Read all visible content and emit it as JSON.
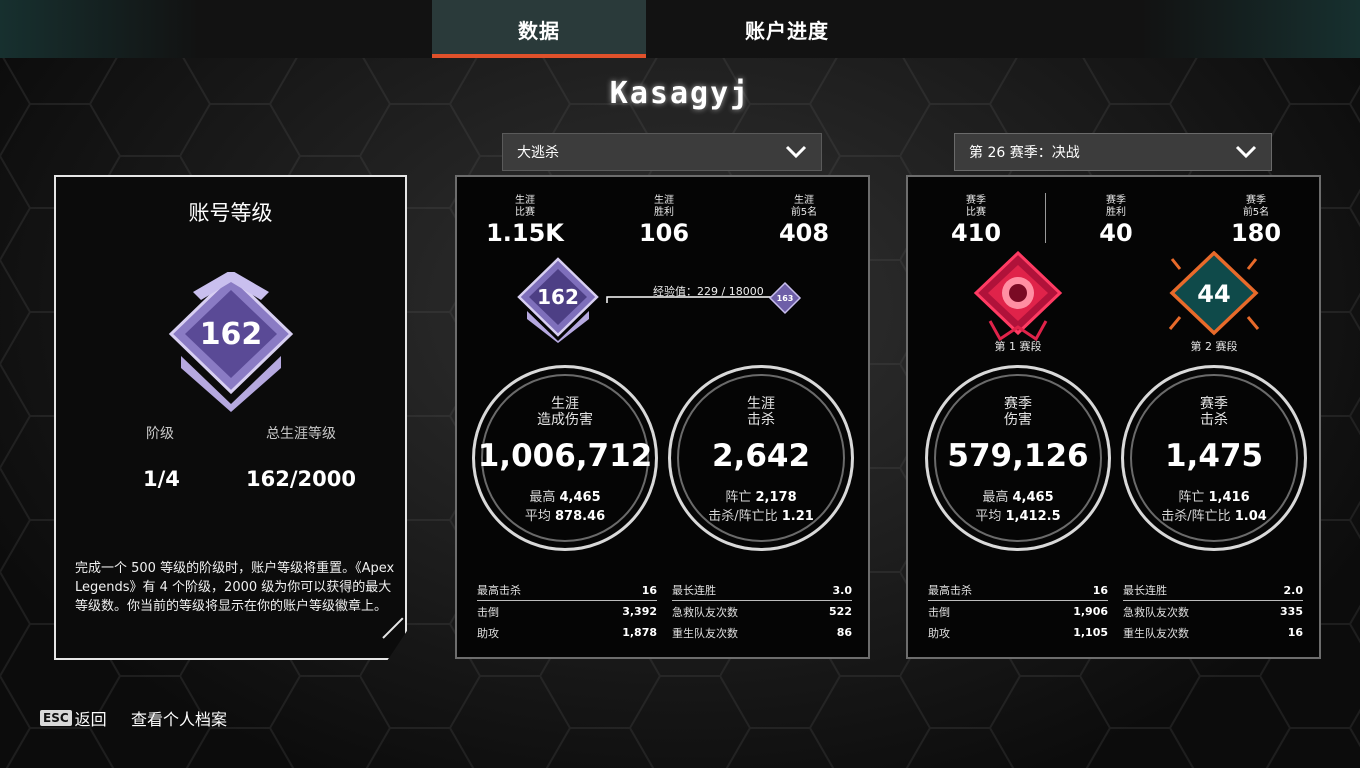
{
  "tabs": [
    {
      "label": "数据",
      "active": true
    },
    {
      "label": "账户进度",
      "active": false
    }
  ],
  "player_name": "Kasagyj",
  "mode_select": {
    "value": "大逃杀"
  },
  "season_select": {
    "value": "第 26 赛季：决战"
  },
  "account": {
    "title": "账号等级",
    "badge_level": "162",
    "tier_label": "阶级",
    "tier_value": "1/4",
    "total_label": "总生涯等级",
    "total_value": "162/2000",
    "description": "完成一个 500 等级的阶级时，账户等级将重置。《Apex Legends》有 4 个阶级，2000 级为你可以获得的最大等级数。你当前的等级将显示在你的账户等级徽章上。"
  },
  "career": {
    "top": [
      {
        "label": "生涯\n比赛",
        "value": "1.15K"
      },
      {
        "label": "生涯\n胜利",
        "value": "106"
      },
      {
        "label": "生涯\n前5名",
        "value": "408"
      }
    ],
    "level_badge": "162",
    "next_level_badge": "163",
    "exp_text": "经验值：229 / 18000",
    "damage": {
      "title": "生涯\n造成伤害",
      "value": "1,006,712",
      "sub1_label": "最高",
      "sub1_value": "4,465",
      "sub2_label": "平均",
      "sub2_value": "878.46"
    },
    "kills": {
      "title": "生涯\n击杀",
      "value": "2,642",
      "sub1_label": "阵亡",
      "sub1_value": "2,178",
      "sub2_label": "击杀/阵亡比",
      "sub2_value": "1.21"
    },
    "table_left": [
      {
        "k": "最高击杀",
        "v": "16"
      },
      {
        "k": "击倒",
        "v": "3,392"
      },
      {
        "k": "助攻",
        "v": "1,878"
      }
    ],
    "table_right": [
      {
        "k": "最长连胜",
        "v": "3.0"
      },
      {
        "k": "急救队友次数",
        "v": "522"
      },
      {
        "k": "重生队友次数",
        "v": "86"
      }
    ]
  },
  "season": {
    "top": [
      {
        "label": "赛季\n比赛",
        "value": "410"
      },
      {
        "label": "赛季\n胜利",
        "value": "40"
      },
      {
        "label": "赛季\n前5名",
        "value": "180"
      }
    ],
    "rank1_label": "第 1 赛段",
    "rank2_label": "第 2 赛段",
    "rank2_number": "44",
    "damage": {
      "title": "赛季\n伤害",
      "value": "579,126",
      "sub1_label": "最高",
      "sub1_value": "4,465",
      "sub2_label": "平均",
      "sub2_value": "1,412.5"
    },
    "kills": {
      "title": "赛季\n击杀",
      "value": "1,475",
      "sub1_label": "阵亡",
      "sub1_value": "1,416",
      "sub2_label": "击杀/阵亡比",
      "sub2_value": "1.04"
    },
    "table_left": [
      {
        "k": "最高击杀",
        "v": "16"
      },
      {
        "k": "击倒",
        "v": "1,906"
      },
      {
        "k": "助攻",
        "v": "1,105"
      }
    ],
    "table_right": [
      {
        "k": "最长连胜",
        "v": "2.0"
      },
      {
        "k": "急救队友次数",
        "v": "335"
      },
      {
        "k": "重生队友次数",
        "v": "16"
      }
    ]
  },
  "footer": {
    "esc_key": "ESC",
    "back_label": "返回",
    "profile_label": "查看个人档案"
  },
  "colors": {
    "accent": "#e0512b",
    "badge_purple": "#a99ad6",
    "rank_red": "#e0234a",
    "rank_orange": "#e86a2a",
    "rank_teal": "#0f4a4a"
  }
}
